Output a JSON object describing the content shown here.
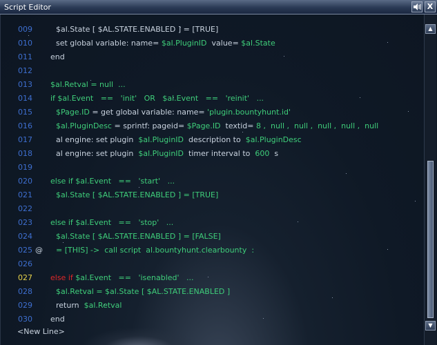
{
  "window": {
    "title": "Script Editor"
  },
  "titlebar_buttons": {
    "sound_icon": "speaker-icon",
    "close_label": "X"
  },
  "lines": [
    {
      "num": "009",
      "tokens": [
        [
          "t",
          "$al.State [ $AL.STATE.ENABLED ] = [TRUE]"
        ]
      ]
    },
    {
      "num": "010",
      "tokens": [
        [
          "t",
          "set global variable: name= "
        ],
        [
          "v",
          "$al.PluginID"
        ],
        [
          "t",
          "  value= "
        ],
        [
          "v",
          "$al.State"
        ]
      ]
    },
    {
      "num": "011",
      "tokens": [
        [
          "t",
          "end"
        ]
      ]
    },
    {
      "num": "012",
      "tokens": []
    },
    {
      "num": "013",
      "tokens": [
        [
          "v",
          "$al.Retval"
        ],
        [
          "v",
          " = null  ..."
        ]
      ]
    },
    {
      "num": "014",
      "tokens": [
        [
          "v",
          "if $al.Event   ==   'init'   OR   $al.Event   ==   'reinit'   ..."
        ]
      ]
    },
    {
      "num": "015",
      "tokens": [
        [
          "v",
          "$Page.ID"
        ],
        [
          "t",
          " = get global variable: name= "
        ],
        [
          "v",
          "'plugin.bountyhunt.id'"
        ]
      ]
    },
    {
      "num": "016",
      "tokens": [
        [
          "v",
          "$al.PluginDesc"
        ],
        [
          "t",
          " = sprintf: pageid= "
        ],
        [
          "v",
          "$Page.ID"
        ],
        [
          "t",
          "  textid= "
        ],
        [
          "v",
          "8 ,  null ,  null ,  null ,  null ,  null"
        ]
      ]
    },
    {
      "num": "017",
      "tokens": [
        [
          "t",
          "al engine: set plugin  "
        ],
        [
          "v",
          "$al.PluginID"
        ],
        [
          "t",
          "  description to  "
        ],
        [
          "v",
          "$al.PluginDesc"
        ]
      ]
    },
    {
      "num": "018",
      "tokens": [
        [
          "t",
          "al engine: set plugin  "
        ],
        [
          "v",
          "$al.PluginID"
        ],
        [
          "t",
          "  timer interval to  "
        ],
        [
          "v",
          "600"
        ],
        [
          "t",
          "  s"
        ]
      ]
    },
    {
      "num": "019",
      "tokens": []
    },
    {
      "num": "020",
      "tokens": [
        [
          "v",
          "else if $al.Event   ==   'start'   ..."
        ]
      ]
    },
    {
      "num": "021",
      "tokens": [
        [
          "v",
          "$al.State [ $AL.STATE.ENABLED ] = [TRUE]"
        ]
      ]
    },
    {
      "num": "022",
      "tokens": []
    },
    {
      "num": "023",
      "tokens": [
        [
          "v",
          "else if $al.Event   ==   'stop'   ..."
        ]
      ]
    },
    {
      "num": "024",
      "tokens": [
        [
          "v",
          "$al.State [ $AL.STATE.ENABLED ] = [FALSE]"
        ]
      ]
    },
    {
      "num": "025",
      "marker": "@",
      "tokens": [
        [
          "v",
          "= [THIS] ->  call script  al.bountyhunt.clearbounty  :"
        ]
      ]
    },
    {
      "num": "026",
      "tokens": []
    },
    {
      "num": "027",
      "highlight": true,
      "tokens": [
        [
          "r",
          "else if"
        ],
        [
          "v",
          " $al.Event   ==   'isenabled'   ..."
        ]
      ]
    },
    {
      "num": "028",
      "tokens": [
        [
          "v",
          "$al.Retval = $al.State [ $AL.STATE.ENABLED ]"
        ]
      ]
    },
    {
      "num": "029",
      "tokens": [
        [
          "t",
          "return  "
        ],
        [
          "v",
          "$al.Retval"
        ]
      ]
    },
    {
      "num": "030",
      "tokens": [
        [
          "t",
          "end"
        ]
      ]
    }
  ],
  "new_line_label": "<New Line>",
  "colors": {
    "line_number": "#3e6fd0",
    "line_number_highlight": "#e8d34a",
    "code_green": "#3fce7a",
    "code_red": "#e02828",
    "text": "#c9d3df"
  }
}
